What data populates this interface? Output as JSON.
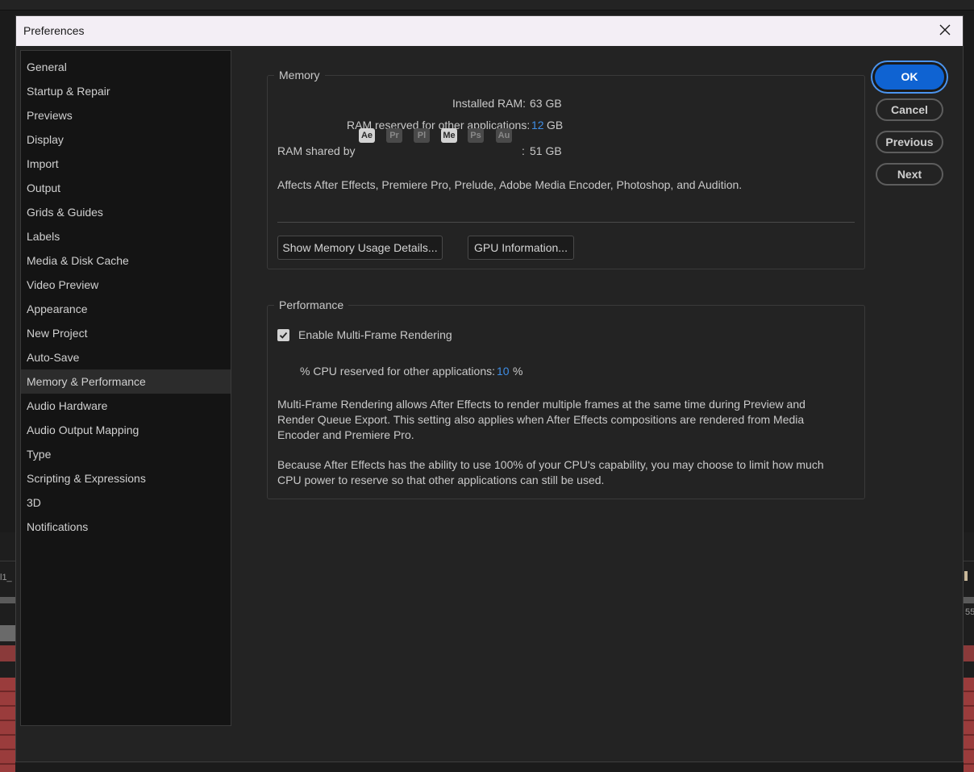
{
  "dialog": {
    "title": "Preferences"
  },
  "sidebar": {
    "items": [
      {
        "label": "General"
      },
      {
        "label": "Startup & Repair"
      },
      {
        "label": "Previews"
      },
      {
        "label": "Display"
      },
      {
        "label": "Import"
      },
      {
        "label": "Output"
      },
      {
        "label": "Grids & Guides"
      },
      {
        "label": "Labels"
      },
      {
        "label": "Media & Disk Cache"
      },
      {
        "label": "Video Preview"
      },
      {
        "label": "Appearance"
      },
      {
        "label": "New Project"
      },
      {
        "label": "Auto-Save"
      },
      {
        "label": "Memory & Performance",
        "selected": true
      },
      {
        "label": "Audio Hardware"
      },
      {
        "label": "Audio Output Mapping"
      },
      {
        "label": "Type"
      },
      {
        "label": "Scripting & Expressions"
      },
      {
        "label": "3D"
      },
      {
        "label": "Notifications"
      }
    ]
  },
  "memory": {
    "section_title": "Memory",
    "installed_label": "Installed RAM:",
    "installed_value": "63 GB",
    "reserved_label": "RAM reserved for other applications:",
    "reserved_value": "12",
    "reserved_unit": "GB",
    "shared_label": "RAM shared by",
    "shared_apps": [
      {
        "abbr": "Ae",
        "active": true
      },
      {
        "abbr": "Pr",
        "active": false
      },
      {
        "abbr": "Pl",
        "active": false
      },
      {
        "abbr": "Me",
        "active": true
      },
      {
        "abbr": "Ps",
        "active": false
      },
      {
        "abbr": "Au",
        "active": false
      }
    ],
    "shared_colon": ":",
    "shared_value": "51 GB",
    "affects_text": "Affects After Effects, Premiere Pro, Prelude, Adobe Media Encoder, Photoshop, and Audition.",
    "show_details_button": "Show Memory Usage Details...",
    "gpu_info_button": "GPU Information..."
  },
  "performance": {
    "section_title": "Performance",
    "mfr_checkbox_label": "Enable Multi-Frame Rendering",
    "mfr_checked": true,
    "cpu_label": "% CPU reserved for other applications:",
    "cpu_value": "10",
    "cpu_unit": "%",
    "description_1": "Multi-Frame Rendering allows After Effects to render multiple frames at the same time during Preview and Render Queue Export. This setting also applies when After Effects compositions are rendered from Media Encoder and Premiere Pro.",
    "description_2": "Because After Effects has the ability to use 100% of your CPU's capability, you may choose to limit how much CPU power to reserve so that other applications can still be used."
  },
  "buttons": {
    "ok": "OK",
    "cancel": "Cancel",
    "previous": "Previous",
    "next": "Next"
  },
  "background": {
    "left_fragment": "l1_",
    "right_fragment": "55"
  },
  "colors": {
    "accent": "#0f63d2",
    "value_blue": "#3f8ee6",
    "dialog_bg": "#232323",
    "sidebar_bg": "#141414"
  },
  "icons": {
    "close": "close-icon",
    "checkbox": "checkmark-icon"
  }
}
